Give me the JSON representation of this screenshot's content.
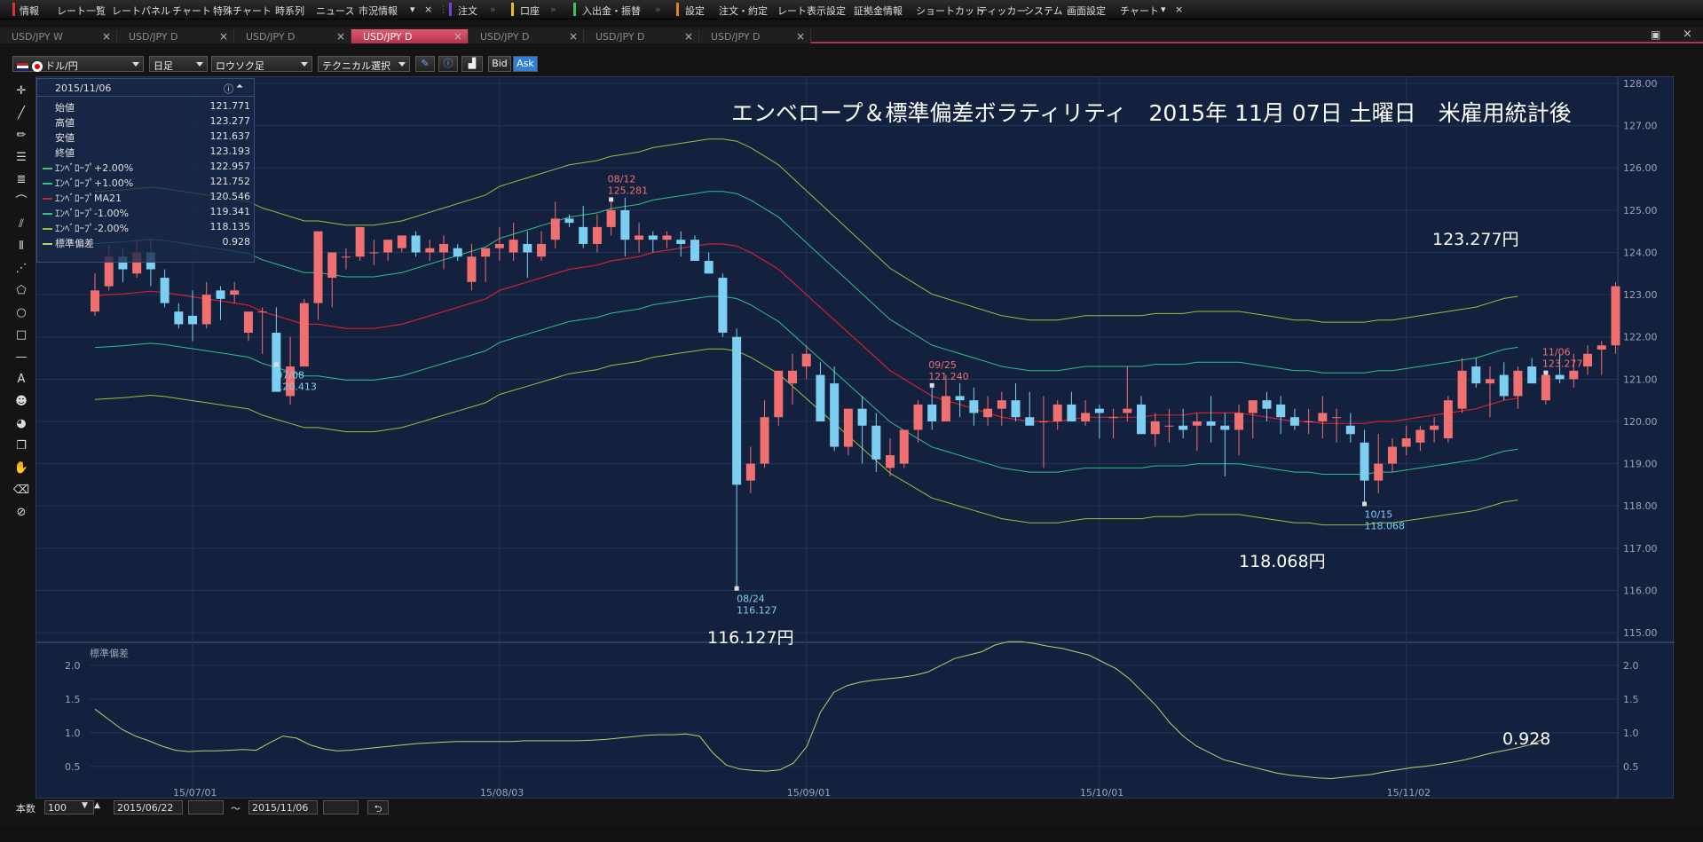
{
  "menubar": {
    "items": [
      "情報",
      "レート一覧",
      "レートパネル",
      "チャート",
      "特殊チャート",
      "時系列",
      "ニュース",
      "市況情報",
      "注文",
      "口座",
      "入出金・振替",
      "設定",
      "注文・約定",
      "レート表示設定",
      "証拠金情報",
      "ショートカット",
      "ティッカー",
      "システム",
      "画面設定",
      "チャート"
    ]
  },
  "tabs": [
    {
      "label": "USD/JPY W",
      "active": false
    },
    {
      "label": "USD/JPY D",
      "active": false
    },
    {
      "label": "USD/JPY D",
      "active": false
    },
    {
      "label": "USD/JPY D",
      "active": true
    },
    {
      "label": "USD/JPY D",
      "active": false
    },
    {
      "label": "USD/JPY D",
      "active": false
    },
    {
      "label": "USD/JPY D",
      "active": false
    }
  ],
  "toolbar": {
    "pair": "ドル/円",
    "period": "日足",
    "chart_style": "ロウソク足",
    "technical": "テクニカル選択",
    "bid": "Bid",
    "ask": "Ask"
  },
  "info_panel": {
    "date": "2015/11/06",
    "rows": [
      {
        "label": "始値",
        "value": "121.771",
        "color": ""
      },
      {
        "label": "高値",
        "value": "123.277",
        "color": ""
      },
      {
        "label": "安値",
        "value": "121.637",
        "color": ""
      },
      {
        "label": "終値",
        "value": "123.193",
        "color": ""
      },
      {
        "label": "ｴﾝﾍﾞﾛｰﾌﾟ+2.00%",
        "value": "122.957",
        "color": "#3ec86d"
      },
      {
        "label": "ｴﾝﾍﾞﾛｰﾌﾟ+1.00%",
        "value": "121.752",
        "color": "#2fbf8f"
      },
      {
        "label": "ｴﾝﾍﾞﾛｰﾌﾟMA21",
        "value": "120.546",
        "color": "#d02030"
      },
      {
        "label": "ｴﾝﾍﾞﾛｰﾌﾟ-1.00%",
        "value": "119.341",
        "color": "#2fbf8f"
      },
      {
        "label": "ｴﾝﾍﾞﾛｰﾌﾟ-2.00%",
        "value": "118.135",
        "color": "#8dc63f"
      },
      {
        "label": "標準偏差",
        "value": "0.928",
        "color": "#b9d36a"
      }
    ]
  },
  "chart_title": "エンベロープ＆標準偏差ボラティリティ　2015年 11月 07日 土曜日　米雇用統計後",
  "big_labels": {
    "high": "123.277円",
    "low_oct": "118.068円",
    "low_aug": "116.127円",
    "sd_last": "0.928"
  },
  "annotations": [
    {
      "date": "07/08",
      "value": "120.413"
    },
    {
      "date": "08/12",
      "value": "125.281"
    },
    {
      "date": "08/24",
      "value": "116.127"
    },
    {
      "date": "09/25",
      "value": "121.240"
    },
    {
      "date": "10/15",
      "value": "118.068"
    },
    {
      "date": "11/06",
      "value": "123.277"
    }
  ],
  "sub_chart_label": "標準偏差",
  "statusbar": {
    "count_label": "本数",
    "count": "100",
    "from": "2015/06/22",
    "tilde": "～",
    "to": "2015/11/06"
  },
  "colors": {
    "up": "#f07070",
    "down": "#7ccff0",
    "ma": "#d02030",
    "env1": "#2fbf8f",
    "env2": "#8dc63f",
    "sd": "#b9d36a",
    "bg": "#13213e"
  },
  "chart_data": [
    {
      "type": "candlestick",
      "title": "エンベロープ＆標準偏差ボラティリティ　2015年 11月 07日 土曜日　米雇用統計後",
      "ylim": [
        115,
        128
      ],
      "y_ticks": [
        "115.00",
        "116.00",
        "117.00",
        "118.00",
        "119.00",
        "120.00",
        "121.00",
        "122.00",
        "123.00",
        "124.00",
        "125.00",
        "126.00",
        "127.00",
        "128.00"
      ],
      "x_ticks": [
        {
          "i": 7,
          "label": "15/07/01"
        },
        {
          "i": 29,
          "label": "15/08/03"
        },
        {
          "i": 51,
          "label": "15/09/01"
        },
        {
          "i": 72,
          "label": "15/10/01"
        },
        {
          "i": 94,
          "label": "15/11/02"
        }
      ],
      "ohlc": [
        [
          122.6,
          123.5,
          122.5,
          123.1
        ],
        [
          123.2,
          124.2,
          123.1,
          123.9
        ],
        [
          123.9,
          124.1,
          123.3,
          123.6
        ],
        [
          123.5,
          124.3,
          123.4,
          124.0
        ],
        [
          124.0,
          124.3,
          123.2,
          123.6
        ],
        [
          123.4,
          123.6,
          122.7,
          122.8
        ],
        [
          122.6,
          122.8,
          122.2,
          122.3
        ],
        [
          122.5,
          123.1,
          121.9,
          122.3
        ],
        [
          122.3,
          123.3,
          122.2,
          123.0
        ],
        [
          123.1,
          123.2,
          122.4,
          122.9
        ],
        [
          123.0,
          123.3,
          122.8,
          123.1
        ],
        [
          122.1,
          122.6,
          121.9,
          122.6
        ],
        [
          122.6,
          122.7,
          121.6,
          122.6
        ],
        [
          122.1,
          122.7,
          121.4,
          120.7
        ],
        [
          120.6,
          122.0,
          120.4,
          121.3
        ],
        [
          121.3,
          122.9,
          121.3,
          122.8
        ],
        [
          122.8,
          124.0,
          122.4,
          124.5
        ],
        [
          123.4,
          124.0,
          122.7,
          124.0
        ],
        [
          123.9,
          124.1,
          123.6,
          123.9
        ],
        [
          123.9,
          124.6,
          123.8,
          124.6
        ],
        [
          124.0,
          124.3,
          123.7,
          124.0
        ],
        [
          124.0,
          124.3,
          123.8,
          124.3
        ],
        [
          124.1,
          124.4,
          124.0,
          124.4
        ],
        [
          124.4,
          124.5,
          123.9,
          124.0
        ],
        [
          124.0,
          124.3,
          123.8,
          124.1
        ],
        [
          124.0,
          124.4,
          123.6,
          124.2
        ],
        [
          124.1,
          124.2,
          123.8,
          123.9
        ],
        [
          123.3,
          124.2,
          123.1,
          123.9
        ],
        [
          123.9,
          124.1,
          123.3,
          124.1
        ],
        [
          124.1,
          124.6,
          123.8,
          124.2
        ],
        [
          124.0,
          124.7,
          123.8,
          124.3
        ],
        [
          124.2,
          124.5,
          123.4,
          124.0
        ],
        [
          123.9,
          124.5,
          123.8,
          124.2
        ],
        [
          124.3,
          125.2,
          124.1,
          124.8
        ],
        [
          124.8,
          124.9,
          124.6,
          124.7
        ],
        [
          124.6,
          125.1,
          124.1,
          124.2
        ],
        [
          124.2,
          124.9,
          124.0,
          124.6
        ],
        [
          124.6,
          125.2,
          124.4,
          125.0
        ],
        [
          125.0,
          125.3,
          123.9,
          124.3
        ],
        [
          124.3,
          124.7,
          124.0,
          124.4
        ],
        [
          124.4,
          124.5,
          124.0,
          124.3
        ],
        [
          124.3,
          124.5,
          124.1,
          124.4
        ],
        [
          124.3,
          124.5,
          123.9,
          124.2
        ],
        [
          124.3,
          124.4,
          123.8,
          123.8
        ],
        [
          123.8,
          124.0,
          123.5,
          123.5
        ],
        [
          123.4,
          123.5,
          122.0,
          122.1
        ],
        [
          122.0,
          122.2,
          116.1,
          118.5
        ],
        [
          118.6,
          119.4,
          118.3,
          119.0
        ],
        [
          119.0,
          120.5,
          118.9,
          120.1
        ],
        [
          120.1,
          121.2,
          119.9,
          121.2
        ],
        [
          120.9,
          121.6,
          120.4,
          121.2
        ],
        [
          121.3,
          121.8,
          121.0,
          121.6
        ],
        [
          121.1,
          121.4,
          120.0,
          120.0
        ],
        [
          120.9,
          121.3,
          119.3,
          119.4
        ],
        [
          119.4,
          120.3,
          119.2,
          120.3
        ],
        [
          120.3,
          120.6,
          119.0,
          119.9
        ],
        [
          119.9,
          120.2,
          118.8,
          119.1
        ],
        [
          118.9,
          119.6,
          118.7,
          119.2
        ],
        [
          119.0,
          119.8,
          118.9,
          119.8
        ],
        [
          119.8,
          120.5,
          119.5,
          120.4
        ],
        [
          120.4,
          120.8,
          119.8,
          120.0
        ],
        [
          120.0,
          121.1,
          120.0,
          120.6
        ],
        [
          120.6,
          120.9,
          120.1,
          120.5
        ],
        [
          120.5,
          120.8,
          119.9,
          120.2
        ],
        [
          120.1,
          120.6,
          119.9,
          120.3
        ],
        [
          120.3,
          120.7,
          119.9,
          120.5
        ],
        [
          120.5,
          120.9,
          120.0,
          120.1
        ],
        [
          120.1,
          120.7,
          120.0,
          119.9
        ],
        [
          120.0,
          120.6,
          118.9,
          120.0
        ],
        [
          120.0,
          120.5,
          119.8,
          120.4
        ],
        [
          120.4,
          120.7,
          120.1,
          120.0
        ],
        [
          120.0,
          120.5,
          119.9,
          120.2
        ],
        [
          120.3,
          120.4,
          119.6,
          120.2
        ],
        [
          120.1,
          120.3,
          119.6,
          120.1
        ],
        [
          120.2,
          121.3,
          120.0,
          120.3
        ],
        [
          120.4,
          120.6,
          119.9,
          119.7
        ],
        [
          119.7,
          120.2,
          119.4,
          120.0
        ],
        [
          119.9,
          120.3,
          119.5,
          119.9
        ],
        [
          119.9,
          120.3,
          119.6,
          119.8
        ],
        [
          119.9,
          120.2,
          119.3,
          120.0
        ],
        [
          120.0,
          120.6,
          119.5,
          119.9
        ],
        [
          119.9,
          120.2,
          118.7,
          119.8
        ],
        [
          119.8,
          120.4,
          119.2,
          120.2
        ],
        [
          120.2,
          120.3,
          119.6,
          120.5
        ],
        [
          120.5,
          120.7,
          120.0,
          120.3
        ],
        [
          120.4,
          120.6,
          119.7,
          120.1
        ],
        [
          120.1,
          120.3,
          119.8,
          119.9
        ],
        [
          120.0,
          120.3,
          119.7,
          120.0
        ],
        [
          120.0,
          120.6,
          119.6,
          120.2
        ],
        [
          120.1,
          120.3,
          119.5,
          120.1
        ],
        [
          119.9,
          120.2,
          119.5,
          119.7
        ],
        [
          119.5,
          119.8,
          118.1,
          118.6
        ],
        [
          118.6,
          119.7,
          118.3,
          119.0
        ],
        [
          119.0,
          119.6,
          118.8,
          119.4
        ],
        [
          119.4,
          119.9,
          119.2,
          119.6
        ],
        [
          119.5,
          119.9,
          119.3,
          119.8
        ],
        [
          119.8,
          120.1,
          119.5,
          119.9
        ],
        [
          119.6,
          120.6,
          119.5,
          120.5
        ],
        [
          120.3,
          121.5,
          120.2,
          121.2
        ],
        [
          121.3,
          121.5,
          120.8,
          120.9
        ],
        [
          120.9,
          121.3,
          120.1,
          121.0
        ],
        [
          121.1,
          121.4,
          120.5,
          120.6
        ],
        [
          120.6,
          121.3,
          120.3,
          121.2
        ],
        [
          121.3,
          121.5,
          120.9,
          120.9
        ],
        [
          120.5,
          121.1,
          120.4,
          121.1
        ],
        [
          121.1,
          121.6,
          120.9,
          121.0
        ],
        [
          121.0,
          121.6,
          120.8,
          121.2
        ],
        [
          121.3,
          121.8,
          121.1,
          121.6
        ],
        [
          121.7,
          121.9,
          121.1,
          121.8
        ],
        [
          121.8,
          123.3,
          121.6,
          123.2
        ]
      ],
      "ma21": [
        122.98,
        123.0,
        123.02,
        123.05,
        123.08,
        123.05,
        123.0,
        122.95,
        122.9,
        122.85,
        122.8,
        122.75,
        122.6,
        122.5,
        122.4,
        122.3,
        122.3,
        122.25,
        122.2,
        122.2,
        122.2,
        122.25,
        122.3,
        122.4,
        122.5,
        122.6,
        122.7,
        122.8,
        122.9,
        123.1,
        123.2,
        123.3,
        123.4,
        123.5,
        123.6,
        123.65,
        123.7,
        123.8,
        123.85,
        123.9,
        124.0,
        124.05,
        124.1,
        124.15,
        124.2,
        124.2,
        124.15,
        124.0,
        123.8,
        123.6,
        123.3,
        123.0,
        122.7,
        122.4,
        122.1,
        121.8,
        121.5,
        121.2,
        121.0,
        120.8,
        120.6,
        120.5,
        120.4,
        120.3,
        120.2,
        120.1,
        120.05,
        120.0,
        120.0,
        120.0,
        120.05,
        120.1,
        120.1,
        120.1,
        120.1,
        120.1,
        120.15,
        120.15,
        120.15,
        120.2,
        120.2,
        120.2,
        120.2,
        120.15,
        120.1,
        120.05,
        120.0,
        120.0,
        119.95,
        119.95,
        119.95,
        119.95,
        120.0,
        120.0,
        120.05,
        120.1,
        120.15,
        120.2,
        120.25,
        120.3,
        120.4,
        120.5,
        120.55
      ],
      "envelope_pct": [
        2.0,
        1.0,
        -1.0,
        -2.0
      ]
    },
    {
      "type": "line",
      "label": "標準偏差",
      "ylim": [
        0.3,
        2.3
      ],
      "y_ticks": [
        "0.5",
        "1.0",
        "1.5",
        "2.0"
      ],
      "values": [
        1.35,
        1.2,
        1.05,
        0.95,
        0.88,
        0.8,
        0.74,
        0.72,
        0.73,
        0.73,
        0.74,
        0.75,
        0.74,
        0.85,
        0.95,
        0.92,
        0.82,
        0.76,
        0.73,
        0.74,
        0.76,
        0.78,
        0.8,
        0.82,
        0.84,
        0.85,
        0.86,
        0.87,
        0.87,
        0.87,
        0.87,
        0.87,
        0.88,
        0.88,
        0.88,
        0.88,
        0.88,
        0.89,
        0.9,
        0.92,
        0.94,
        0.96,
        0.97,
        0.97,
        0.98,
        0.95,
        0.7,
        0.52,
        0.46,
        0.44,
        0.43,
        0.45,
        0.55,
        0.8,
        1.3,
        1.6,
        1.7,
        1.75,
        1.78,
        1.8,
        1.82,
        1.85,
        1.9,
        2.0,
        2.1,
        2.15,
        2.2,
        2.3,
        2.35,
        2.35,
        2.32,
        2.28,
        2.25,
        2.2,
        2.15,
        2.05,
        1.95,
        1.8,
        1.6,
        1.4,
        1.15,
        0.95,
        0.8,
        0.7,
        0.6,
        0.55,
        0.5,
        0.45,
        0.4,
        0.37,
        0.35,
        0.33,
        0.32,
        0.34,
        0.36,
        0.38,
        0.42,
        0.45,
        0.48,
        0.5,
        0.53,
        0.56,
        0.6,
        0.65,
        0.7,
        0.74,
        0.78,
        0.83,
        0.928
      ]
    }
  ]
}
